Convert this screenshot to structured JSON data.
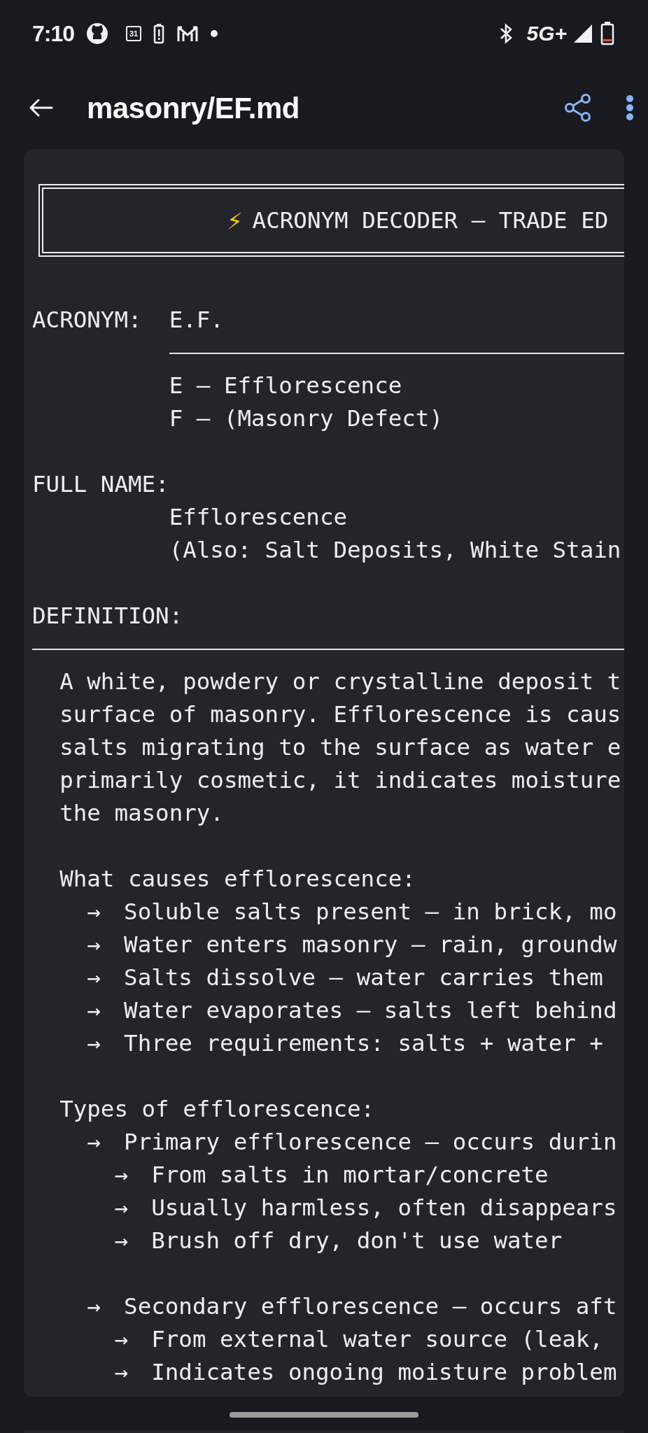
{
  "status_bar": {
    "time": "7:10",
    "calendar_day": "31",
    "network": "5G+",
    "battery_low": true
  },
  "app_bar": {
    "title": "masonry/EF.md"
  },
  "document": {
    "banner_icon": "⚡",
    "banner": "ACRONYM DECODER — TRADE ED",
    "lines": [
      {
        "kind": "field",
        "label": "ACRONYM:",
        "value": "E.F."
      },
      {
        "kind": "rule",
        "inset": true
      },
      {
        "kind": "value",
        "text": "E — Efflorescence"
      },
      {
        "kind": "value",
        "text": "F — (Masonry Defect)"
      },
      {
        "kind": "blank"
      },
      {
        "kind": "field",
        "label": "FULL NAME:"
      },
      {
        "kind": "value",
        "text": "Efflorescence"
      },
      {
        "kind": "value",
        "text": "(Also: Salt Deposits, White Stain"
      },
      {
        "kind": "blank"
      },
      {
        "kind": "field",
        "label": "DEFINITION:"
      },
      {
        "kind": "rule",
        "inset": false
      },
      {
        "kind": "body",
        "text": "A white, powdery or crystalline deposit t"
      },
      {
        "kind": "body",
        "text": "surface of masonry. Efflorescence is caus"
      },
      {
        "kind": "body",
        "text": "salts migrating to the surface as water e"
      },
      {
        "kind": "body",
        "text": "primarily cosmetic, it indicates moisture"
      },
      {
        "kind": "body",
        "text": "the masonry."
      },
      {
        "kind": "blank"
      },
      {
        "kind": "body",
        "text": "What causes efflorescence:"
      },
      {
        "kind": "bullet",
        "marker": "→",
        "text": "Soluble salts present — in brick, mo"
      },
      {
        "kind": "bullet",
        "marker": "→",
        "text": "Water enters masonry — rain, groundw"
      },
      {
        "kind": "bullet",
        "marker": "→",
        "text": "Salts dissolve — water carries them"
      },
      {
        "kind": "bullet",
        "marker": "→",
        "text": "Water evaporates — salts left behind"
      },
      {
        "kind": "bullet",
        "marker": "→",
        "text": "Three requirements: salts + water +"
      },
      {
        "kind": "blank"
      },
      {
        "kind": "body",
        "text": "Types of efflorescence:"
      },
      {
        "kind": "bullet",
        "marker": "→",
        "text": "Primary efflorescence — occurs durin",
        "children": [
          {
            "marker": "→",
            "text": "From salts in mortar/concrete"
          },
          {
            "marker": "→",
            "text": "Usually harmless, often disappears"
          },
          {
            "marker": "→",
            "text": "Brush off dry, don't use water"
          }
        ]
      },
      {
        "kind": "blank"
      },
      {
        "kind": "bullet",
        "marker": "→",
        "text": "Secondary efflorescence — occurs aft",
        "children": [
          {
            "marker": "→",
            "text": "From external water source (leak,"
          },
          {
            "marker": "→",
            "text": "Indicates ongoing moisture problem"
          }
        ]
      }
    ]
  }
}
